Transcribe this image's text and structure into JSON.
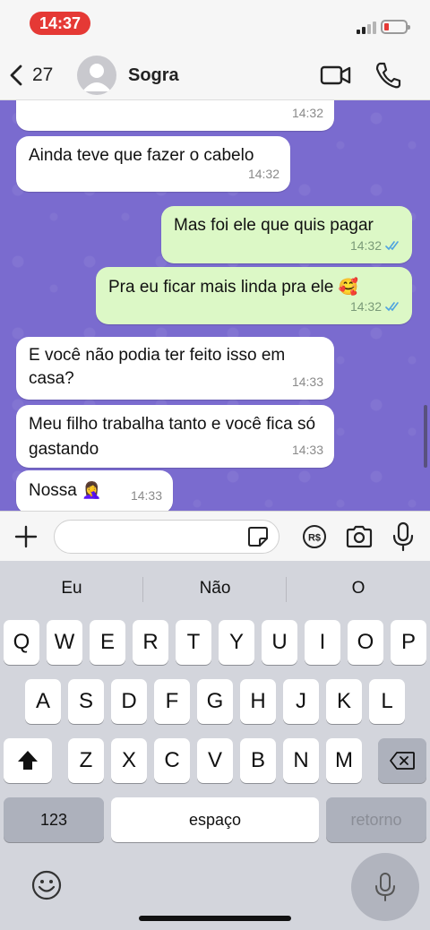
{
  "status_bar": {
    "time": "14:37"
  },
  "header": {
    "back_count": "27",
    "contact_name": "Sogra"
  },
  "messages": [
    {
      "direction": "in",
      "text": "",
      "time": "14:32"
    },
    {
      "direction": "in",
      "text": "Ainda teve que fazer o cabelo",
      "time": "14:32"
    },
    {
      "direction": "out",
      "text": "Mas foi ele que quis pagar",
      "time": "14:32",
      "status": "read"
    },
    {
      "direction": "out",
      "text": "Pra eu ficar mais linda pra ele",
      "emoji": "🥰",
      "time": "14:32",
      "status": "read"
    },
    {
      "direction": "in",
      "text": "E você não podia ter feito isso em casa?",
      "time": "14:33"
    },
    {
      "direction": "in",
      "text": "Meu filho trabalha tanto e você fica só gastando",
      "time": "14:33"
    },
    {
      "direction": "in",
      "text": "Nossa",
      "emoji": "🤦‍♀️",
      "time": "14:33"
    }
  ],
  "composer": {
    "value": "",
    "placeholder": ""
  },
  "keyboard": {
    "suggestions": [
      "Eu",
      "Não",
      "O"
    ],
    "row1": [
      "Q",
      "W",
      "E",
      "R",
      "T",
      "Y",
      "U",
      "I",
      "O",
      "P"
    ],
    "row2": [
      "A",
      "S",
      "D",
      "F",
      "G",
      "H",
      "J",
      "K",
      "L"
    ],
    "row3": [
      "Z",
      "X",
      "C",
      "V",
      "B",
      "N",
      "M"
    ],
    "numbers_key": "123",
    "space_key": "espaço",
    "return_key": "retorno"
  },
  "colors": {
    "chat_background": "#7a6bcf",
    "incoming_bubble": "#ffffff",
    "outgoing_bubble": "#dcf8c6",
    "read_ticks": "#4fa3e0",
    "time_pill": "#e53935"
  },
  "icons": [
    "back-chevron-icon",
    "avatar-icon",
    "video-call-icon",
    "phone-icon",
    "plus-icon",
    "sticker-icon",
    "pay-icon",
    "camera-icon",
    "microphone-icon",
    "shift-icon",
    "backspace-icon",
    "emoji-icon"
  ]
}
